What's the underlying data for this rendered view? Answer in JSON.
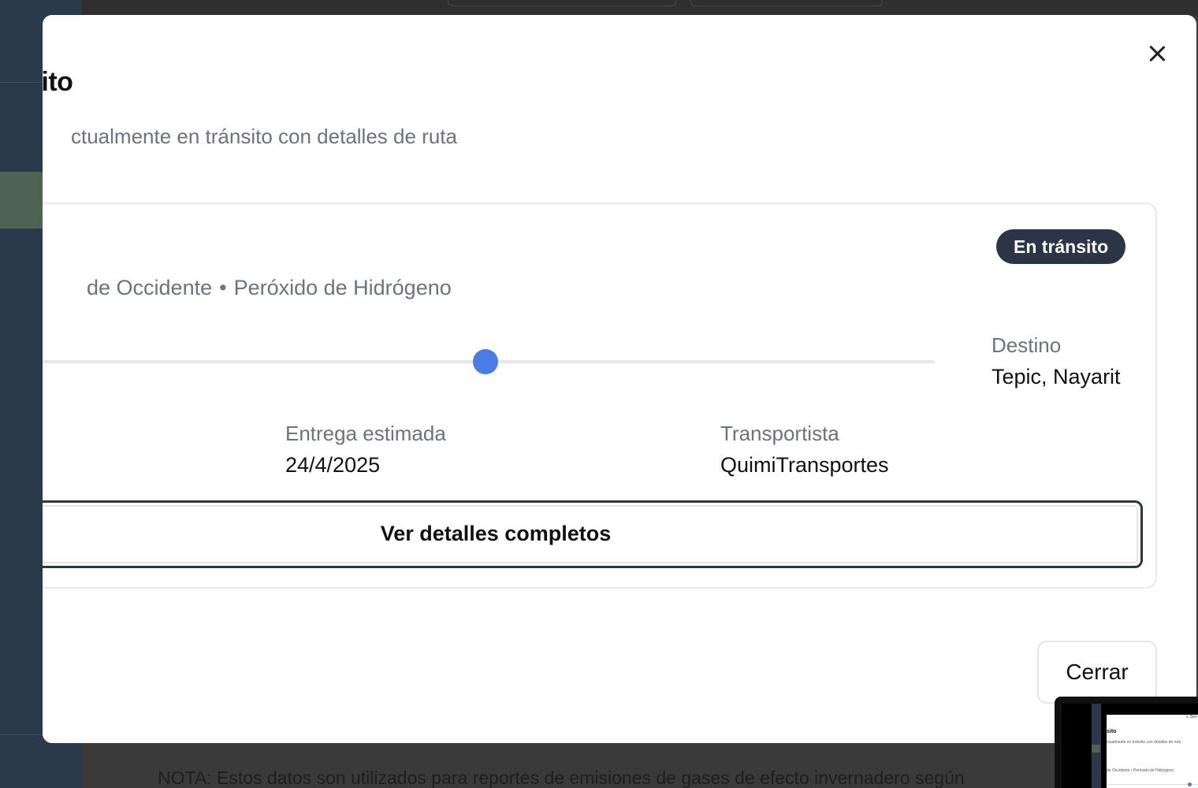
{
  "background": {
    "note": "NOTA: Estos datos son utilizados para reportes de emisiones de gases de efecto invernadero según"
  },
  "modal": {
    "title": "sito",
    "description": "ctualmente en tránsito con detalles de ruta",
    "close_icon": "close-icon"
  },
  "shipment": {
    "status_badge": "En tránsito",
    "subtitle_part1": "de Occidente",
    "subtitle_separator": "•",
    "subtitle_part2": "Peróxido de Hidrógeno",
    "progress": 0.5,
    "destination_label": "Destino",
    "destination_value": "Tepic, Nayarit",
    "eta_label": "Entrega estimada",
    "eta_value": "24/4/2025",
    "carrier_label": "Transportista",
    "carrier_value": "QuimiTransportes",
    "details_button": "Ver detalles completos"
  },
  "footer": {
    "close_button": "Cerrar"
  },
  "thumbnail": {
    "title": "sito",
    "description": "ctualmente en tránsito con detalles de ruta",
    "subtitle": "de Occidente • Peróxido de Hidrógeno",
    "corner_text": "⚠ Seo"
  },
  "colors": {
    "sidebar": "#2b3a4a",
    "sidebar_active": "#4f6352",
    "badge": "#2b3545",
    "progress_dot": "#4b7be5"
  }
}
